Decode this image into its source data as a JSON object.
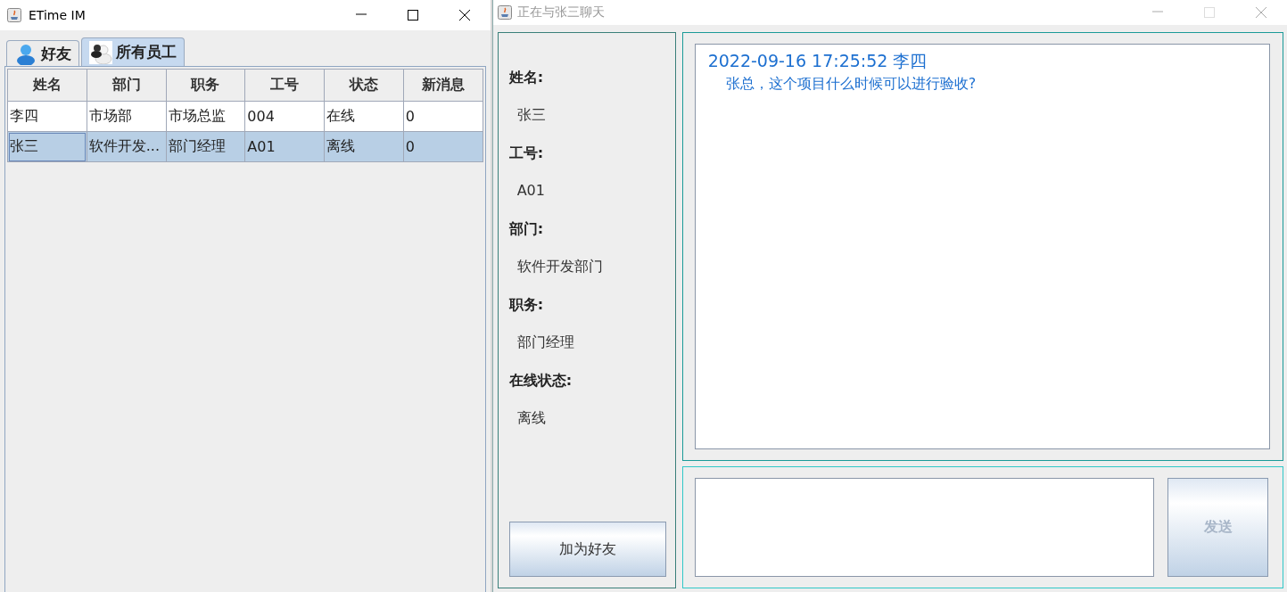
{
  "main_window": {
    "title": "ETime IM",
    "focused": true,
    "tabs": [
      {
        "label": "好友",
        "selected": false
      },
      {
        "label": "所有员工",
        "selected": true
      }
    ],
    "table": {
      "columns": [
        "姓名",
        "部门",
        "职务",
        "工号",
        "状态",
        "新消息"
      ],
      "rows": [
        {
          "cells": [
            "李四",
            "市场部",
            "市场总监",
            "004",
            "在线",
            "0"
          ],
          "selected": false
        },
        {
          "cells": [
            "张三",
            "软件开发...",
            "部门经理",
            "A01",
            "离线",
            "0"
          ],
          "selected": true
        }
      ]
    }
  },
  "chat_window": {
    "title": "正在与张三聊天",
    "focused": false,
    "profile": [
      {
        "label": "姓名:",
        "value": "张三"
      },
      {
        "label": "工号:",
        "value": "A01"
      },
      {
        "label": "部门:",
        "value": "软件开发部门"
      },
      {
        "label": "职务:",
        "value": "部门经理"
      },
      {
        "label": "在线状态:",
        "value": "离线"
      }
    ],
    "add_friend_button": {
      "label": "加为好友",
      "disabled": false
    },
    "messages": [
      {
        "header": "2022-09-16 17:25:52 李四",
        "body": "张总，这个项目什么时候可以进行验收?"
      }
    ],
    "send_button": {
      "label": "发送",
      "disabled": true
    }
  }
}
